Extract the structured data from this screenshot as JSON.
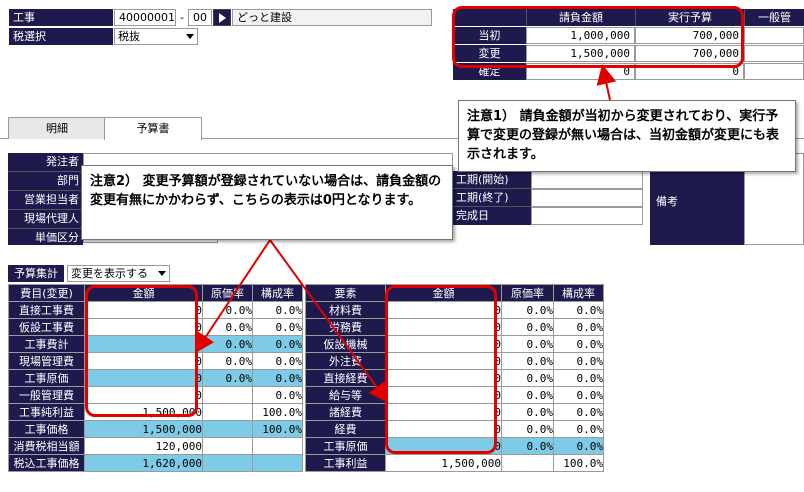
{
  "top": {
    "koji_label": "工事",
    "koji_code": "40000001",
    "koji_dash": "-",
    "koji_sub": "00",
    "koji_name": "どっと建設",
    "tax_label": "税選択",
    "tax_value": "税抜"
  },
  "amounts": {
    "col1": "請負金額",
    "col2": "実行予算",
    "col3": "一般管",
    "rows": [
      {
        "label": "当初",
        "v1": "1,000,000",
        "v2": "700,000"
      },
      {
        "label": "変更",
        "v1": "1,500,000",
        "v2": "700,000"
      },
      {
        "label": "確定",
        "v1": "0",
        "v2": "0"
      }
    ]
  },
  "tabs": [
    "明細",
    "予算書"
  ],
  "info_labels": [
    "発注者",
    "部門",
    "営業担当者",
    "現場代理人",
    "単価区分"
  ],
  "period_labels": [
    "工期(開始)",
    "工期(終了)",
    "完成日"
  ],
  "remarks_label": "備考",
  "budget": {
    "summary_label": "予算集計",
    "select_value": "変更を表示する",
    "left_headers": [
      "費目(変更)",
      "金額",
      "原価率",
      "構成率"
    ],
    "left_rows": [
      {
        "name": "直接工事費",
        "amount": "0",
        "cost_rate": "0.0%",
        "comp_rate": "0.0%",
        "hl": false
      },
      {
        "name": "仮設工事費",
        "amount": "0",
        "cost_rate": "0.0%",
        "comp_rate": "0.0%",
        "hl": false
      },
      {
        "name": "工事費計",
        "amount": "0",
        "cost_rate": "0.0%",
        "comp_rate": "0.0%",
        "hl": true
      },
      {
        "name": "現場管理費",
        "amount": "0",
        "cost_rate": "0.0%",
        "comp_rate": "0.0%",
        "hl": false
      },
      {
        "name": "工事原価",
        "amount": "0",
        "cost_rate": "0.0%",
        "comp_rate": "0.0%",
        "hl": true
      },
      {
        "name": "一般管理費",
        "amount": "0",
        "cost_rate": "",
        "comp_rate": "0.0%",
        "hl": false
      },
      {
        "name": "工事純利益",
        "amount": "1,500,000",
        "cost_rate": "",
        "comp_rate": "100.0%",
        "hl": false
      },
      {
        "name": "工事価格",
        "amount": "1,500,000",
        "cost_rate": "",
        "comp_rate": "100.0%",
        "hl": true
      },
      {
        "name": "消費税相当額",
        "amount": "120,000",
        "cost_rate": "",
        "comp_rate": "",
        "hl": false
      },
      {
        "name": "税込工事価格",
        "amount": "1,620,000",
        "cost_rate": "",
        "comp_rate": "",
        "hl": true
      }
    ],
    "right_headers": [
      "要素",
      "金額",
      "原価率",
      "構成率"
    ],
    "right_rows": [
      {
        "name": "材料費",
        "amount": "0",
        "cost_rate": "0.0%",
        "comp_rate": "0.0%",
        "hl": false
      },
      {
        "name": "労務費",
        "amount": "0",
        "cost_rate": "0.0%",
        "comp_rate": "0.0%",
        "hl": false
      },
      {
        "name": "仮設機械",
        "amount": "0",
        "cost_rate": "0.0%",
        "comp_rate": "0.0%",
        "hl": false
      },
      {
        "name": "外注費",
        "amount": "0",
        "cost_rate": "0.0%",
        "comp_rate": "0.0%",
        "hl": false
      },
      {
        "name": "直接経費",
        "amount": "0",
        "cost_rate": "0.0%",
        "comp_rate": "0.0%",
        "hl": false
      },
      {
        "name": "給与等",
        "amount": "0",
        "cost_rate": "0.0%",
        "comp_rate": "0.0%",
        "hl": false
      },
      {
        "name": "諸経費",
        "amount": "0",
        "cost_rate": "0.0%",
        "comp_rate": "0.0%",
        "hl": false
      },
      {
        "name": "経費",
        "amount": "0",
        "cost_rate": "0.0%",
        "comp_rate": "0.0%",
        "hl": false
      },
      {
        "name": "工事原価",
        "amount": "0",
        "cost_rate": "0.0%",
        "comp_rate": "0.0%",
        "hl": true
      },
      {
        "name": "工事利益",
        "amount": "1,500,000",
        "cost_rate": "",
        "comp_rate": "100.0%",
        "hl": false
      }
    ]
  },
  "notes": {
    "note1": "注意1） 請負金額が当初から変更されており、実行予算で変更の登録が無い場合は、当初金額が変更にも表示されます。",
    "note2": "注意2） 変更予算額が登録されていない場合は、請負金額の変更有無にかかわらず、こちらの表示は0円となります。"
  },
  "colors": {
    "header": "#1e1a4e",
    "highlight": "#7ecbe8",
    "annotation": "#e00000"
  }
}
